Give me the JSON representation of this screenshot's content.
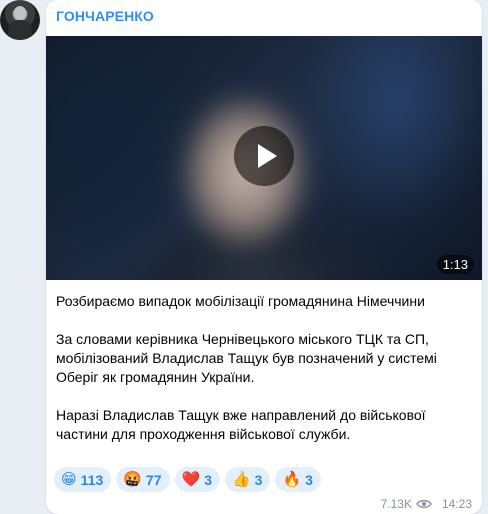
{
  "channel": {
    "name": "ГОНЧАРЕНКО",
    "accent_color": "#3390ec"
  },
  "video": {
    "duration": "1:13",
    "play_icon": "play-icon"
  },
  "message": {
    "paragraphs": [
      "Розбираємо випадок мобілізації громадянина Німеччини",
      "За словами керівника Чернівецького міського ТЦК та СП, мобілізований Владислав Тащук був позначений у системі Оберіг як громадянин України.",
      "Наразі Владислав Тащук вже направлений до військової частини для проходження військової служби."
    ]
  },
  "reactions": [
    {
      "emoji": "😁",
      "count": "113",
      "icon": "grin-emoji"
    },
    {
      "emoji": "🤬",
      "count": "77",
      "icon": "angry-emoji"
    },
    {
      "emoji": "❤️",
      "count": "3",
      "icon": "heart-emoji"
    },
    {
      "emoji": "👍",
      "count": "3",
      "icon": "thumbs-up-emoji"
    },
    {
      "emoji": "🔥",
      "count": "3",
      "icon": "fire-emoji"
    }
  ],
  "meta": {
    "views": "7.13K",
    "views_icon": "eye-icon",
    "time": "14:23"
  }
}
